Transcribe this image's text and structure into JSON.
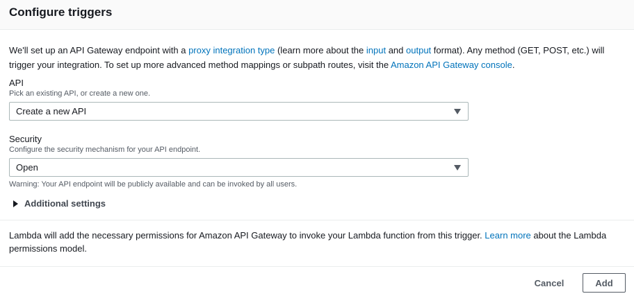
{
  "header": {
    "title": "Configure triggers"
  },
  "intro": {
    "part1": "We'll set up an API Gateway endpoint with a ",
    "link_proxy": "proxy integration type",
    "part2": " (learn more about the ",
    "link_input": "input",
    "part3": " and ",
    "link_output": "output",
    "part4": " format). Any method (GET, POST, etc.) will trigger your integration. To set up more advanced method mappings or subpath routes, visit the ",
    "link_console": "Amazon API Gateway console",
    "part5": "."
  },
  "api_field": {
    "label": "API",
    "description": "Pick an existing API, or create a new one.",
    "selected": "Create a new API"
  },
  "security_field": {
    "label": "Security",
    "description": "Configure the security mechanism for your API endpoint.",
    "selected": "Open",
    "warning": "Warning: Your API endpoint will be publicly available and can be invoked by all users."
  },
  "additional_settings": {
    "label": "Additional settings",
    "expanded": false
  },
  "permissions_note": {
    "part1": "Lambda will add the necessary permissions for Amazon API Gateway to invoke your Lambda function from this trigger. ",
    "link_learn_more": "Learn more",
    "part2": " about the Lambda permissions model."
  },
  "footer": {
    "cancel_label": "Cancel",
    "add_label": "Add"
  },
  "colors": {
    "link": "#0073bb",
    "text": "#16191f",
    "secondary_text": "#545b64",
    "border": "#aab7b8",
    "header_bg": "#fafafa"
  }
}
